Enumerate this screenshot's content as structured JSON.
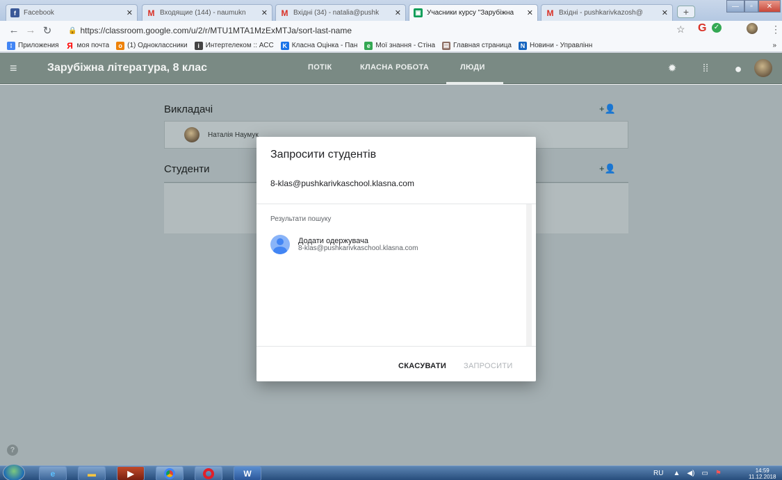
{
  "browser": {
    "tabs": [
      {
        "title": "Facebook",
        "icon": "facebook-icon",
        "color": "#3b5998",
        "glyph": "f"
      },
      {
        "title": "Входящие (144) - naumukn",
        "icon": "gmail-icon",
        "color": "#d93025",
        "glyph": "M"
      },
      {
        "title": "Вхідні (34) - natalia@pushk",
        "icon": "gmail-icon",
        "color": "#d93025",
        "glyph": "M"
      },
      {
        "title": "Учасники курсу \"Зарубіжна",
        "icon": "classroom-icon",
        "color": "#0f9d58",
        "glyph": "▣"
      },
      {
        "title": "Вхідні - pushkarivkazosh@",
        "icon": "gmail-icon",
        "color": "#d93025",
        "glyph": "M"
      }
    ],
    "url": "https://classroom.google.com/u/2/r/MTU1MTA1MzExMTJa/sort-last-name",
    "bookmarks": [
      {
        "label": "Приложения",
        "icon": "apps-grid-icon",
        "color": "#4285f4",
        "glyph": "⁞"
      },
      {
        "label": "моя почта",
        "icon": "yandex-icon",
        "color": "#ff0000",
        "glyph": "Я"
      },
      {
        "label": "(1) Одноклассники",
        "icon": "odnoklassniki-icon",
        "color": "#ee8208",
        "glyph": "o"
      },
      {
        "label": "Интертелеком :: АСС",
        "icon": "intertelecom-icon",
        "color": "#444444",
        "glyph": "i"
      },
      {
        "label": "Класна Оцінка - Пан",
        "icon": "klasna-icon",
        "color": "#1a73e8",
        "glyph": "K"
      },
      {
        "label": "Мої знання - Стіна",
        "icon": "moi-znannya-icon",
        "color": "#34a853",
        "glyph": "e"
      },
      {
        "label": "Главная страница",
        "icon": "book-icon",
        "color": "#8d6e63",
        "glyph": "▤"
      },
      {
        "label": "Новини - Управлінн",
        "icon": "news-icon",
        "color": "#1565c0",
        "glyph": "N"
      }
    ],
    "bookmarks_more": "»"
  },
  "appbar": {
    "course_title": "Зарубіжна література, 8 клас",
    "tabs": [
      "ПОТІК",
      "КЛАСНА РОБОТА",
      "ЛЮДИ"
    ],
    "active_tab": "ЛЮДИ"
  },
  "people": {
    "teachers_heading": "Викладачі",
    "teacher_name": "Наталія Наумук",
    "students_heading": "Студенти"
  },
  "dialog": {
    "title": "Запросити студентів",
    "email_value": "8-klas@pushkarivkaschool.klasna.com",
    "results_label": "Результати пошуку",
    "recipient_name": "Додати одержувача",
    "recipient_email": "8-klas@pushkarivkaschool.klasna.com",
    "cancel_label": "СКАСУВАТИ",
    "invite_label": "ЗАПРОСИТИ"
  },
  "taskbar": {
    "lang": "RU",
    "time": "14:59",
    "date": "11.12.2018"
  }
}
